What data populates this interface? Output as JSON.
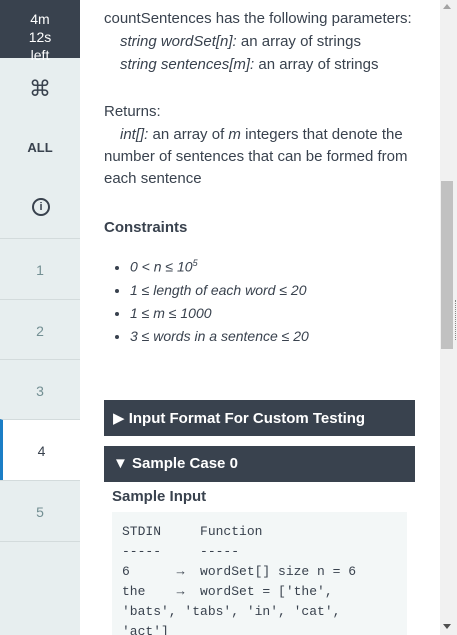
{
  "sidebar": {
    "timer": "4m 12s left",
    "cmd_icon": "⌘",
    "all_label": "ALL",
    "info_icon": "i",
    "questions": [
      "1",
      "2",
      "3",
      "4",
      "5"
    ],
    "active_question": "4"
  },
  "problem": {
    "intro": "countSentences has the following parameters:",
    "param1_type": "string wordSet[n]:",
    "param1_desc": " an array of strings",
    "param2_type": "string sentences[m]:",
    "param2_desc": " an array of strings",
    "returns_label": "Returns:",
    "returns_type": "int[]:",
    "returns_desc_a": " an array of ",
    "returns_m": "m",
    "returns_desc_b": " integers that denote the number of sentences that can be formed from each sentence",
    "constraints_heading": "Constraints",
    "constraints": [
      "0 < n ≤ 10",
      "1 ≤ length of each word ≤ 20",
      "1 ≤ m ≤ 1000",
      "3 ≤  words in a sentence ≤ 20"
    ],
    "constraint0_sup": "5"
  },
  "sections": {
    "input_format": "▶ Input Format For Custom Testing",
    "sample_case": "▼ Sample Case 0",
    "sample_input_label": "Sample Input"
  },
  "code": {
    "lines": [
      "STDIN     Function",
      "-----     -----",
      "",
      "6      →  wordSet[] size n = 6",
      "the    →  wordSet = ['the',",
      "'bats', 'tabs', 'in', 'cat',",
      "'act']"
    ]
  }
}
